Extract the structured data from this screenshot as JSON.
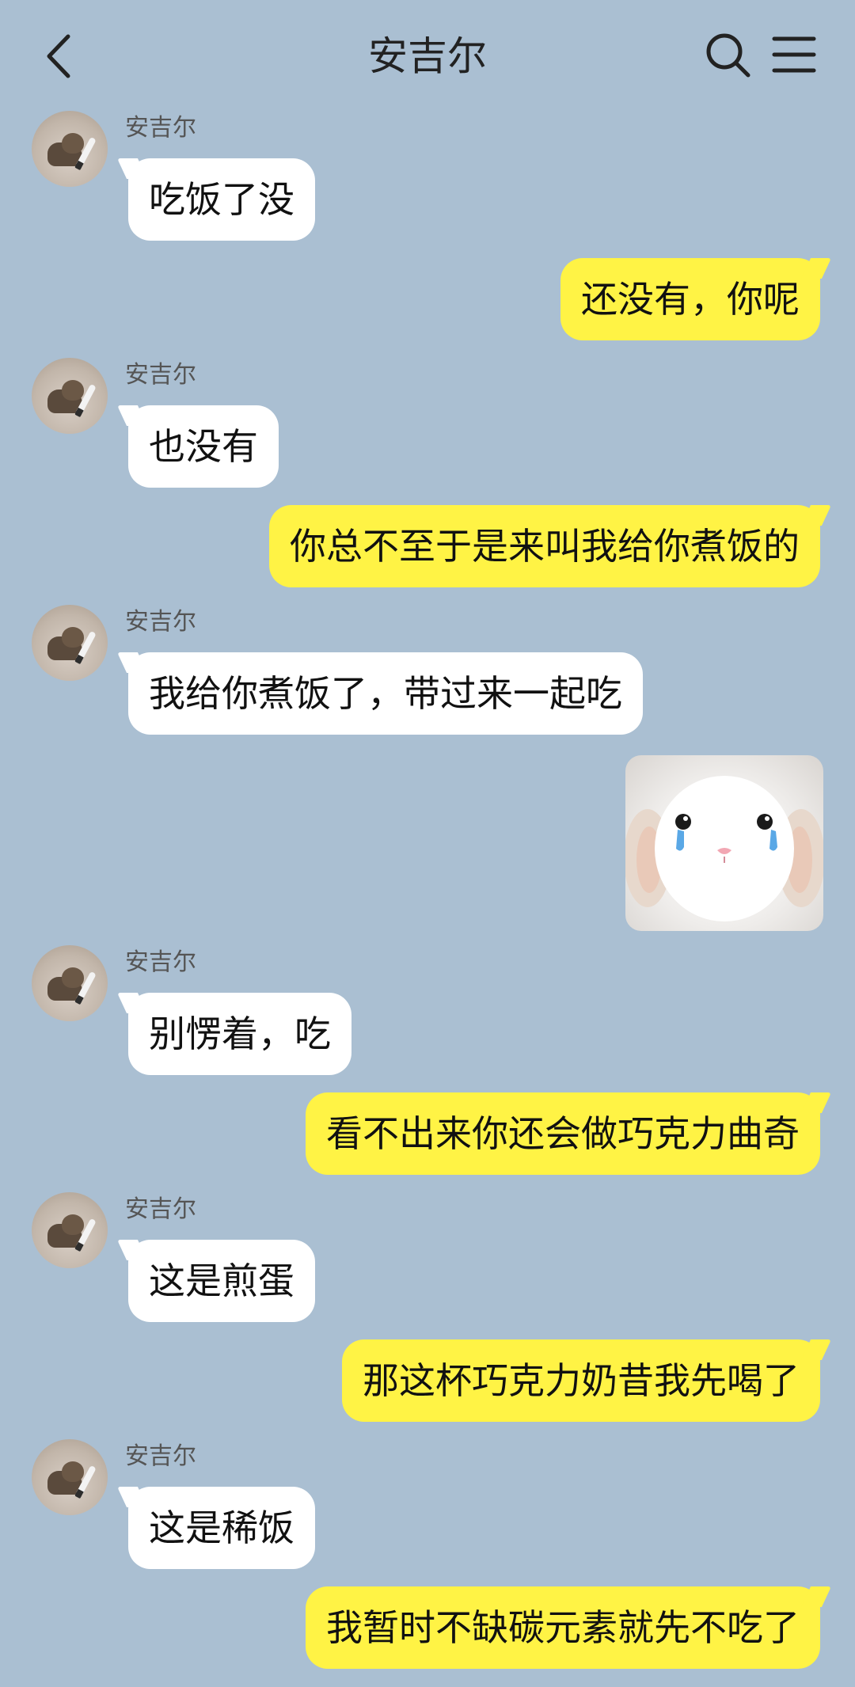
{
  "header": {
    "title": "安吉尔"
  },
  "messages": [
    {
      "type": "incoming",
      "sender": "安吉尔",
      "text": "吃饭了没"
    },
    {
      "type": "outgoing",
      "text": "还没有，你呢"
    },
    {
      "type": "incoming",
      "sender": "安吉尔",
      "text": "也没有"
    },
    {
      "type": "outgoing",
      "text": "你总不至于是来叫我给你煮饭的"
    },
    {
      "type": "incoming",
      "sender": "安吉尔",
      "text": "我给你煮饭了，带过来一起吃"
    },
    {
      "type": "outgoing-sticker",
      "icon": "crying-bunny-sticker"
    },
    {
      "type": "incoming",
      "sender": "安吉尔",
      "text": "别愣着，吃"
    },
    {
      "type": "outgoing",
      "text": "看不出来你还会做巧克力曲奇"
    },
    {
      "type": "incoming",
      "sender": "安吉尔",
      "text": "这是煎蛋"
    },
    {
      "type": "outgoing",
      "text": "那这杯巧克力奶昔我先喝了"
    },
    {
      "type": "incoming",
      "sender": "安吉尔",
      "text": "这是稀饭"
    },
    {
      "type": "outgoing",
      "text": "我暂时不缺碳元素就先不吃了"
    }
  ],
  "colors": {
    "background": "#aabfd2",
    "outgoing_bubble": "#fff345",
    "incoming_bubble": "#ffffff"
  }
}
